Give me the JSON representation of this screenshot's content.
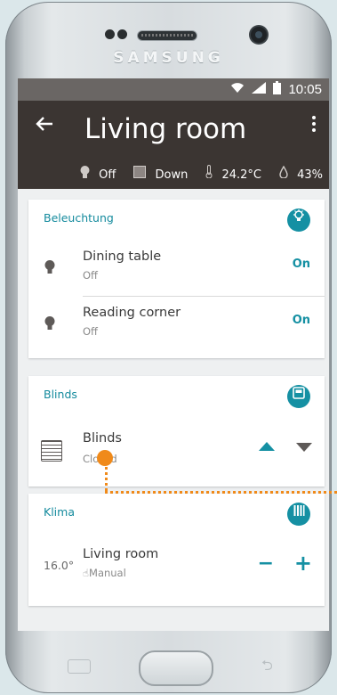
{
  "device": {
    "brand": "SAMSUNG"
  },
  "statusbar": {
    "time": "10:05"
  },
  "appbar": {
    "title": "Living room",
    "summary": {
      "light_state": "Off",
      "blinds_state": "Down",
      "temperature": "24.2°C",
      "humidity": "43%"
    }
  },
  "lighting": {
    "title": "Beleuchtung",
    "items": [
      {
        "name": "Dining table",
        "state": "Off",
        "action": "On"
      },
      {
        "name": "Reading corner",
        "state": "Off",
        "action": "On"
      }
    ]
  },
  "blinds": {
    "title": "Blinds",
    "item": {
      "name": "Blinds",
      "state": "Closed"
    }
  },
  "climate": {
    "title": "Klima",
    "item": {
      "name": "Living room",
      "mode": "Manual",
      "setpoint": "16.0°"
    }
  },
  "colors": {
    "accent": "#1590a3",
    "appbar": "#3b3532",
    "annotation": "#f08a1a"
  }
}
